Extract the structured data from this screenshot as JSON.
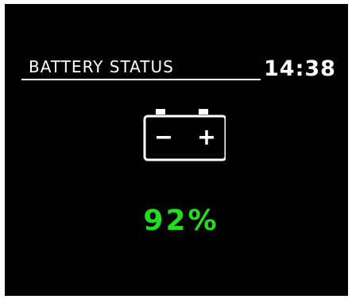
{
  "screen": {
    "title": "BATTERY STATUS",
    "clock": "14:38"
  },
  "battery": {
    "icon": "car-battery-icon",
    "level_text": "92%",
    "level_percent": 92,
    "level_color": "#22dd22"
  },
  "colors": {
    "background": "#000000",
    "foreground": "#ffffff"
  }
}
